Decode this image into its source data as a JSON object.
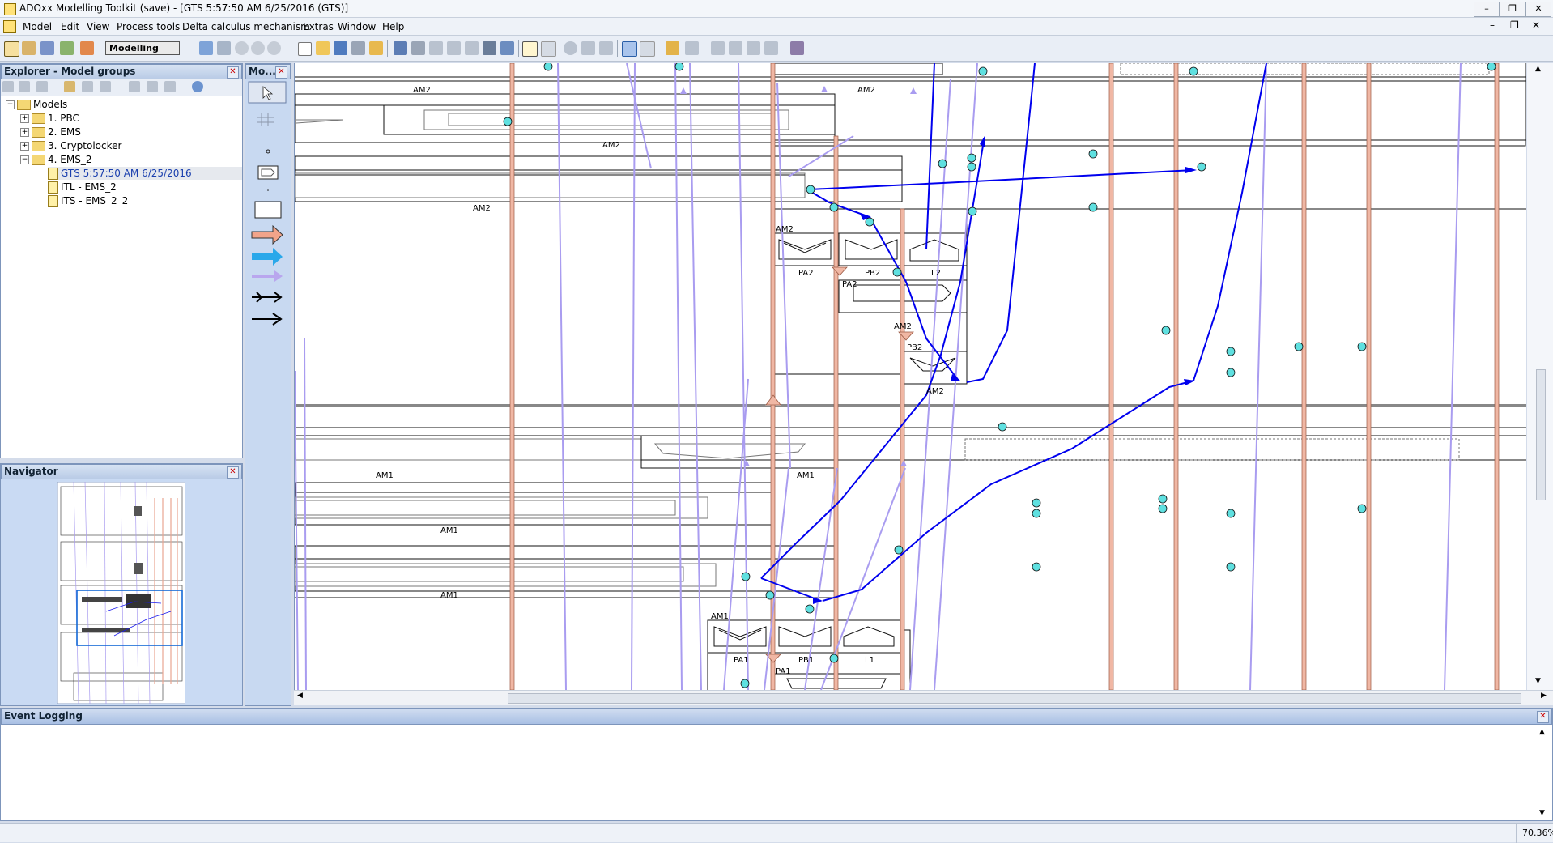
{
  "window": {
    "title": "ADOxx Modelling Toolkit (save) - [GTS 5:57:50 AM 6/25/2016 (GTS)]",
    "buttons": [
      "–",
      "❐",
      "✕"
    ]
  },
  "menu": [
    "Model",
    "Edit",
    "View",
    "Process tools",
    "Delta calculus mechanism",
    "Extras",
    "Window",
    "Help"
  ],
  "toolbar": {
    "mode": "Modelling"
  },
  "explorer": {
    "title": "Explorer - Model groups",
    "tree": [
      {
        "label": "Models",
        "level": 0,
        "expander": "⊟",
        "kind": "folder"
      },
      {
        "label": "1. PBC",
        "level": 1,
        "expander": "⊞",
        "kind": "folder"
      },
      {
        "label": "2. EMS",
        "level": 1,
        "expander": "⊞",
        "kind": "folder"
      },
      {
        "label": "3. Cryptolocker",
        "level": 1,
        "expander": "⊞",
        "kind": "folder"
      },
      {
        "label": "4. EMS_2",
        "level": 1,
        "expander": "⊟",
        "kind": "folder"
      },
      {
        "label": "GTS 5:57:50 AM 6/25/2016",
        "level": 2,
        "expander": "",
        "kind": "model",
        "selected": true
      },
      {
        "label": "ITL - EMS_2",
        "level": 2,
        "expander": "",
        "kind": "model"
      },
      {
        "label": "ITS - EMS_2_2",
        "level": 2,
        "expander": "",
        "kind": "model"
      }
    ]
  },
  "palette": {
    "title": "Mo..."
  },
  "navigator": {
    "title": "Navigator"
  },
  "event_logging": {
    "title": "Event Logging"
  },
  "status": {
    "zoom": "70.36%"
  },
  "canvas": {
    "labels": {
      "am2_top_left": "AM2",
      "am2_top_right": "AM2",
      "am2_b": "AM2",
      "am2_c": "AM2",
      "am2_box": "AM2",
      "pa2_label": "PA2",
      "pb2_label": "PB2",
      "l2_label": "L2",
      "pa2_sub": "PA2",
      "am2_sub": "AM2",
      "pb2_sub": "PB2",
      "am2_bottom": "AM2",
      "am1_a": "AM1",
      "am1_b": "AM1",
      "am1_c": "AM1",
      "am1_d": "AM1",
      "am1_box": "AM1",
      "pa1_label": "PA1",
      "pb1_label": "PB1",
      "l1_label": "L1",
      "pa1_sub": "PA1"
    }
  },
  "colors": {
    "accent": "#3366cc",
    "flow": "#0000ee",
    "lavender": "#a99cf0",
    "salmon": "#e8a591",
    "node": "#5fe0e0"
  }
}
